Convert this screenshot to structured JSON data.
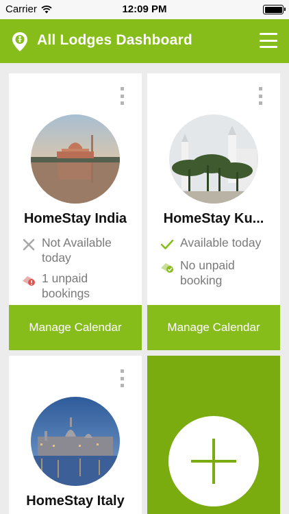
{
  "status_bar": {
    "carrier": "Carrier",
    "time": "12:09 PM"
  },
  "app_bar": {
    "title": "All Lodges Dashboard"
  },
  "lodges": [
    {
      "name": "HomeStay India",
      "availability": "Not Available today",
      "availability_icon": "cross-icon",
      "payment": "1 unpaid bookings",
      "payment_icon": "unpaid-alert-icon",
      "action_label": "Manage Calendar"
    },
    {
      "name": "HomeStay Ku...",
      "availability": "Available today",
      "availability_icon": "check-icon",
      "payment": "No unpaid booking",
      "payment_icon": "paid-check-icon",
      "action_label": "Manage Calendar"
    },
    {
      "name": "HomeStay Italy"
    }
  ],
  "colors": {
    "brand": "#87bd1b",
    "brand_dark": "#7aac10",
    "text_muted": "#7a7a7a",
    "alert": "#e0544d"
  }
}
